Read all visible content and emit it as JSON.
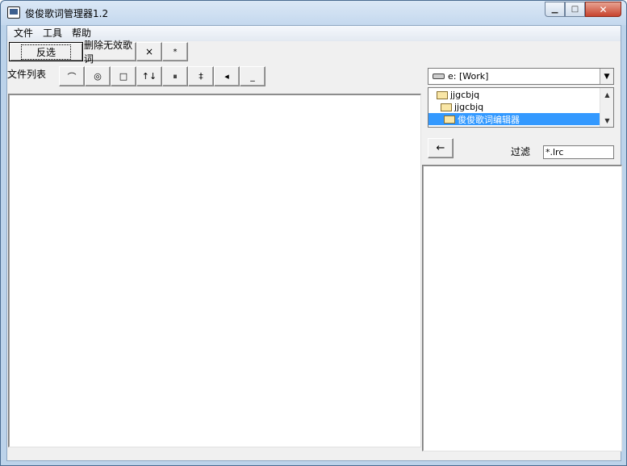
{
  "window": {
    "title": "俊俊歌词管理器1.2",
    "caption": {
      "minimize": "▁",
      "maximize": "□",
      "close": "✕"
    }
  },
  "menu": [
    "文件",
    "工具",
    "帮助"
  ],
  "toolbar": {
    "invert_select": "反选",
    "delete_invalid": "删除无效歌词",
    "close_btn": "×",
    "star_btn": "*"
  },
  "file_list": {
    "label": "文件列表",
    "tools": [
      {
        "name": "arc-icon",
        "glyph": "⌒"
      },
      {
        "name": "target-icon",
        "glyph": "◎"
      },
      {
        "name": "square-icon",
        "glyph": "□"
      },
      {
        "name": "up-down-arrows-icon",
        "glyph": "↑↓"
      },
      {
        "name": "pause-icon",
        "glyph": "⏸"
      },
      {
        "name": "double-bar-icon",
        "glyph": "‡"
      },
      {
        "name": "left-triangle-icon",
        "glyph": "◂"
      },
      {
        "name": "underscore-icon",
        "glyph": "_"
      }
    ]
  },
  "drive": {
    "value": "e: [Work]",
    "icon": "drive-icon"
  },
  "directories": [
    {
      "label": "jjgcbjq",
      "indent": 1,
      "selected": false
    },
    {
      "label": "jjgcbjq",
      "indent": 2,
      "selected": false
    },
    {
      "label": "俊俊歌词编辑器",
      "indent": 3,
      "selected": true
    }
  ],
  "back_button": "←",
  "filter": {
    "label": "过滤",
    "value": "*.lrc"
  },
  "colors": {
    "selection": "#3399ff",
    "titlebar": "#c4d8ee"
  }
}
